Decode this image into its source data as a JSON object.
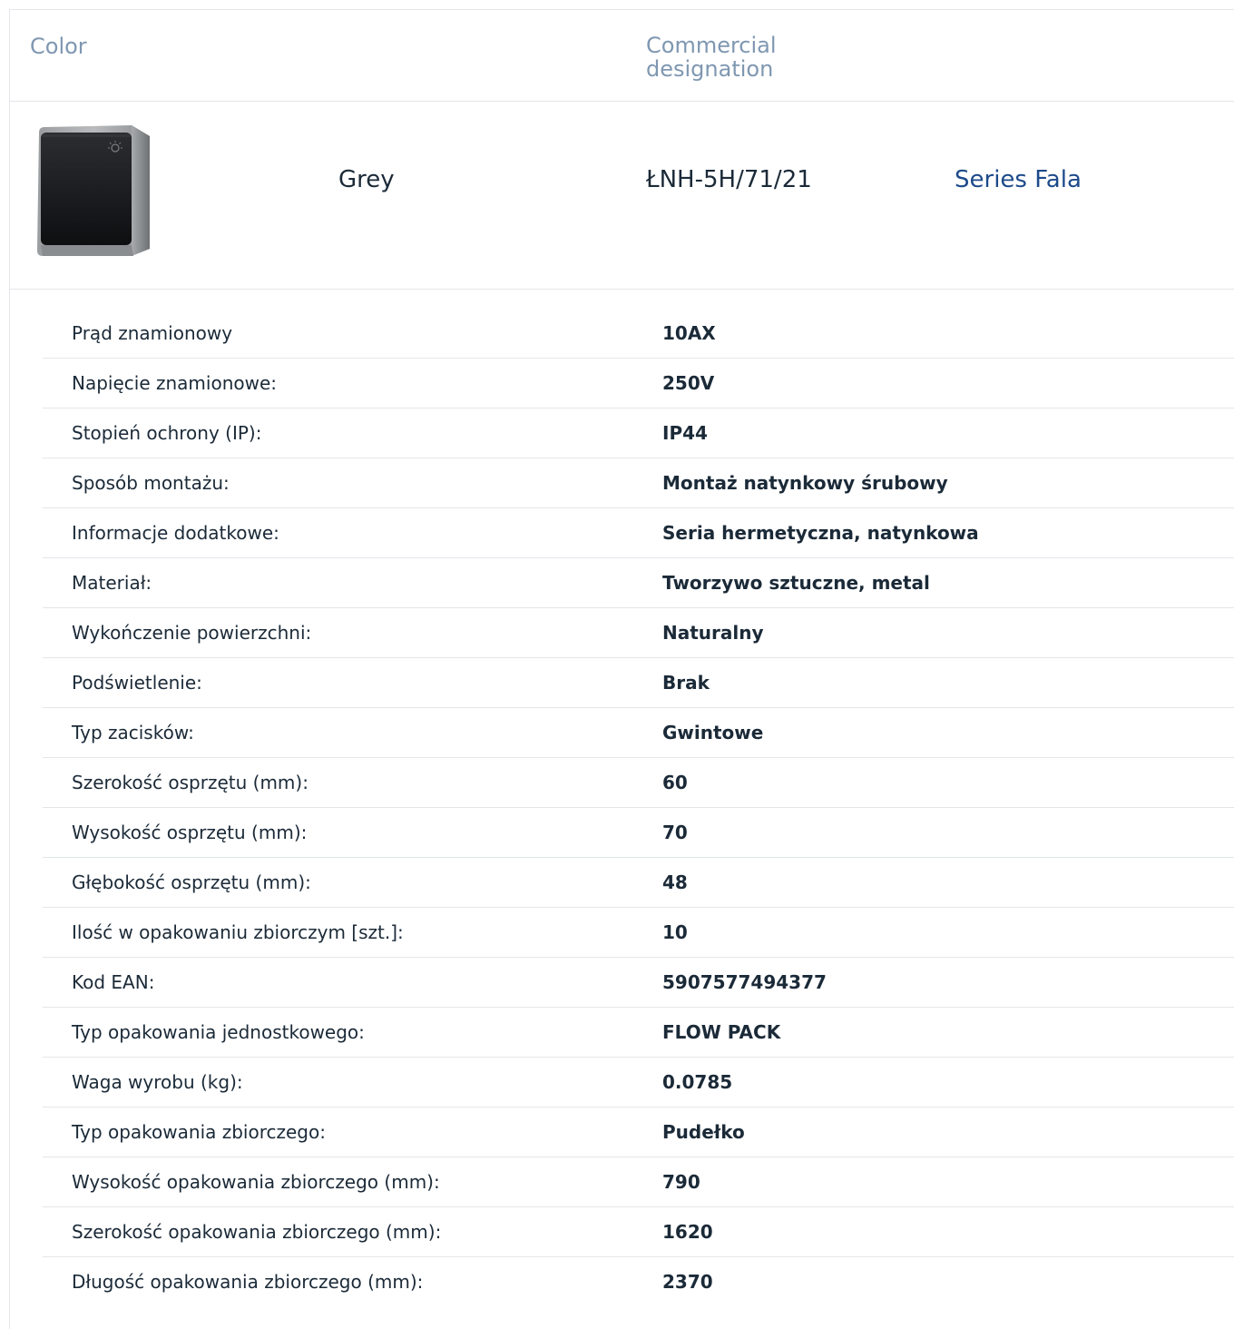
{
  "header": {
    "color_label": "Color",
    "designation_label": "Commercial designation"
  },
  "product": {
    "image_icon": "light-switch-icon",
    "color": "Grey",
    "designation": "ŁNH-5H/71/21",
    "series_link": "Series Fala"
  },
  "specs": [
    {
      "label": "Prąd znamionowy",
      "value": "10AX"
    },
    {
      "label": "Napięcie znamionowe:",
      "value": "250V"
    },
    {
      "label": "Stopień ochrony (IP):",
      "value": "IP44"
    },
    {
      "label": "Sposób montażu:",
      "value": "Montaż natynkowy śrubowy"
    },
    {
      "label": "Informacje dodatkowe:",
      "value": "Seria hermetyczna, natynkowa"
    },
    {
      "label": "Materiał:",
      "value": "Tworzywo sztuczne, metal"
    },
    {
      "label": "Wykończenie powierzchni:",
      "value": "Naturalny"
    },
    {
      "label": "Podświetlenie:",
      "value": "Brak"
    },
    {
      "label": "Typ zacisków:",
      "value": "Gwintowe"
    },
    {
      "label": "Szerokość osprzętu (mm):",
      "value": "60"
    },
    {
      "label": "Wysokość osprzętu (mm):",
      "value": "70"
    },
    {
      "label": "Głębokość osprzętu (mm):",
      "value": "48"
    },
    {
      "label": "Ilość w opakowaniu zbiorczym [szt.]:",
      "value": "10"
    },
    {
      "label": "Kod EAN:",
      "value": "5907577494377"
    },
    {
      "label": "Typ opakowania jednostkowego:",
      "value": "FLOW PACK"
    },
    {
      "label": "Waga wyrobu (kg):",
      "value": "0.0785"
    },
    {
      "label": "Typ opakowania zbiorczego:",
      "value": "Pudełko"
    },
    {
      "label": "Wysokość opakowania zbiorczego (mm):",
      "value": "790"
    },
    {
      "label": "Szerokość opakowania zbiorczego (mm):",
      "value": "1620"
    },
    {
      "label": "Długość opakowania zbiorczego (mm):",
      "value": "2370"
    }
  ]
}
